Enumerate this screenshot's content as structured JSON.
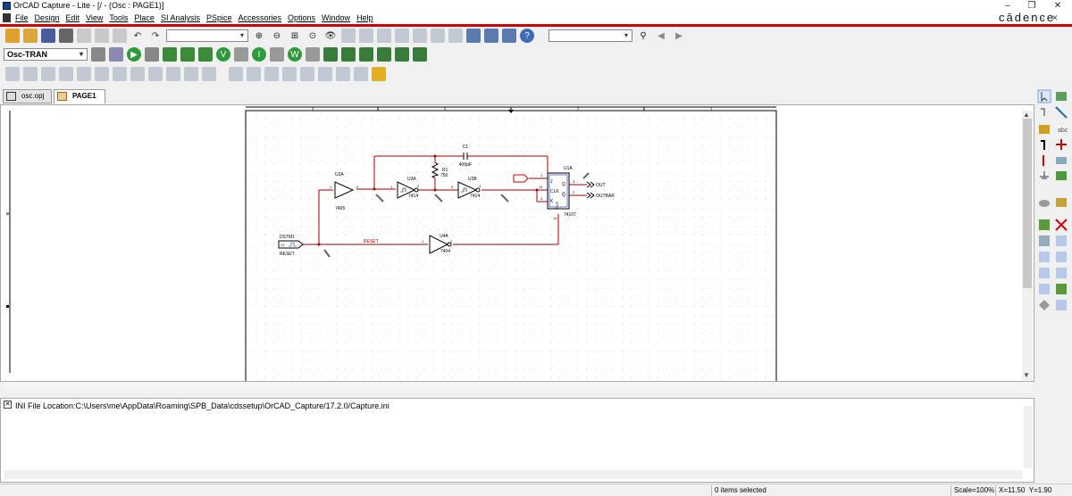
{
  "window": {
    "title": "OrCAD Capture - Lite - [/ - (Osc : PAGE1)]",
    "minimize": "–",
    "maximize": "❐",
    "close": "✕"
  },
  "menu": [
    "File",
    "Design",
    "Edit",
    "View",
    "Tools",
    "Place",
    "SI Analysis",
    "PSpice",
    "Accessories",
    "Options",
    "Window",
    "Help"
  ],
  "brand": "cādence",
  "toolbar": {
    "part_combo": "",
    "search_combo": "",
    "profile_combo": "Osc-TRAN"
  },
  "tabs": [
    {
      "label": "osc.opj"
    },
    {
      "label": "PAGE1"
    }
  ],
  "ruler": [
    "4",
    "3",
    "2",
    "1"
  ],
  "schematic": {
    "parts": {
      "u2a": {
        "ref": "U2A",
        "type": "7405",
        "pin_in": "1",
        "pin_out": "2"
      },
      "u3a": {
        "ref": "U3A",
        "type": "7414",
        "pin_in": "1",
        "pin_out": "2"
      },
      "u3b": {
        "ref": "U3B",
        "type": "7414",
        "pin_in": "3",
        "pin_out": "4"
      },
      "u4a": {
        "ref": "U4A",
        "type": "7404",
        "pin_in": "1",
        "pin_out": "2"
      },
      "u1a": {
        "ref": "U1A",
        "type": "74107",
        "pin_j": "1",
        "pin_clk": "12",
        "pin_k": "4",
        "pin_q": "3",
        "pin_qbar": "2",
        "pin_clr": "13",
        "lbl_j": "J",
        "lbl_clk": "CLK",
        "lbl_k": "K",
        "lbl_q": "Q",
        "lbl_qbar": "Q̅",
        "lbl_clr": "CLR"
      },
      "c1": {
        "ref": "C1",
        "value": "400pF"
      },
      "r1": {
        "ref": "R1",
        "value": "750"
      },
      "dstm1": {
        "ref": "DSTM1",
        "symbol": "S1",
        "net": "RESET"
      }
    },
    "nets": {
      "reset": "RESET",
      "out": "OUT",
      "outbar": "OUTBAR"
    }
  },
  "output": {
    "text": "INI File Location:C:\\Users\\me\\AppData\\Roaming\\SPB_Data\\cdssetup\\OrCAD_Capture/17.2.0/Capture.ini"
  },
  "status": {
    "selection": "0 items selected",
    "scale": "Scale=100%",
    "coords": "X=11.50  Y=1.90"
  }
}
